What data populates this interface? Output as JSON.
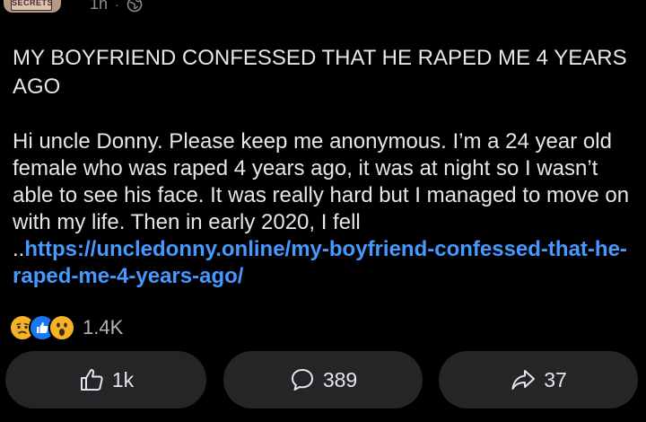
{
  "author": {
    "avatar_banner_text": "SECRETS"
  },
  "meta": {
    "time": "1h",
    "separator": "·",
    "audience_icon": "globe-icon"
  },
  "post": {
    "title": "MY BOYFRIEND CONFESSED THAT HE RAPED ME 4 YEARS AGO",
    "body_text": "Hi uncle Donny. Please keep me anonymous. I’m a 24 year old female who was raped 4 years ago, it was at night so I wasn’t able to see his face. It was really hard but I managed to move on with my life. Then in early 2020, I fell ..",
    "link_text": "https://uncledonny.online/my-boyfriend-confessed-that-he-raped-me-4-years-ago/"
  },
  "reactions": {
    "icons": [
      "sad-reaction-icon",
      "like-reaction-icon",
      "wow-reaction-icon"
    ],
    "count": "1.4K"
  },
  "actions": {
    "like": {
      "icon": "thumbs-up-icon",
      "count": "1k"
    },
    "comment": {
      "icon": "comment-bubble-icon",
      "count": "389"
    },
    "share": {
      "icon": "share-arrow-icon",
      "count": "37"
    }
  },
  "colors": {
    "background": "#000000",
    "text": "#e4e6eb",
    "muted_text": "#8a8d91",
    "link": "#4599ff",
    "button_bg": "#242526",
    "like_blue": "#1877f2",
    "reaction_yellow": "#f7b125"
  }
}
